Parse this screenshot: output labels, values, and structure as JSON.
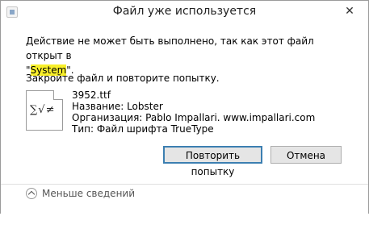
{
  "window": {
    "title": "Файл уже используется",
    "close_glyph": "✕"
  },
  "message": {
    "line1_before": "Действие не может быть выполнено, так как этот файл открыт в",
    "quote_open": "\"",
    "highlighted_app": "System",
    "quote_close": "\".",
    "instruction": "Закройте файл и повторите попытку."
  },
  "file": {
    "icon_glyphs": "∑√≠",
    "name": "3952.ttf",
    "title_line": "Название: Lobster",
    "organization_line": "Организация: Pablo Impallari. www.impallari.com",
    "type_line": "Тип: Файл шрифта TrueType"
  },
  "buttons": {
    "retry_label": "Повторить попытку",
    "cancel_label": "Отмена"
  },
  "footer": {
    "details_label": "Меньше сведений"
  },
  "colors": {
    "highlight": "#f8ef2a",
    "default_button_border": "#3c7fb1"
  },
  "icons": {
    "title_icon": "file-in-use-icon",
    "close_icon": "close-icon",
    "file_icon": "font-file-icon",
    "details_icon": "chevron-up-circle-icon"
  }
}
